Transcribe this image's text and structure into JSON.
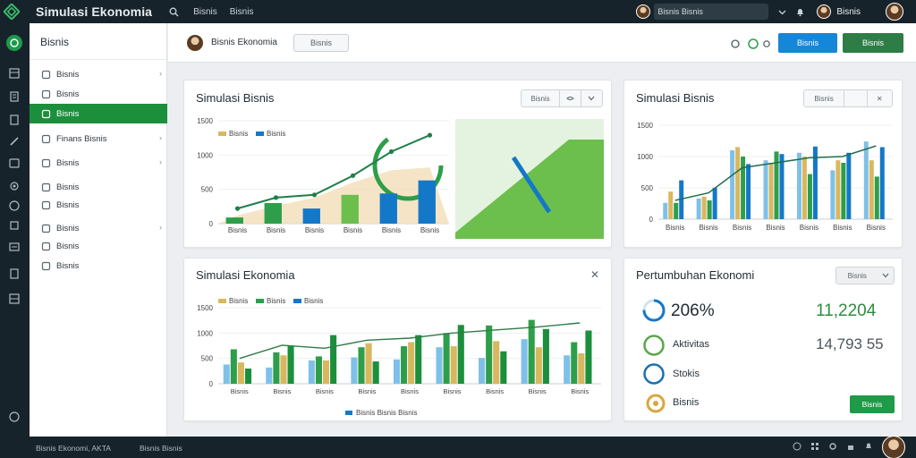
{
  "app": {
    "title": "Simulasi Ekonomia"
  },
  "topbar": {
    "menu": [
      "Bisnis",
      "Bisnis"
    ],
    "search_text": "Bisnis Bisnis",
    "user_name": "Bisnis"
  },
  "sidebar": {
    "title": "Bisnis",
    "items": [
      {
        "label": "Bisnis",
        "icon": "briefcase-icon",
        "chevron": true
      },
      {
        "label": "Bisnis",
        "icon": "twitter-bird-icon",
        "chevron": false
      },
      {
        "label": "Bisnis",
        "icon": "chart-icon",
        "chevron": false,
        "active": true
      },
      {
        "label": "Finans Bisnis",
        "icon": "chat-icon",
        "chevron": true
      },
      {
        "label": "Bisnis",
        "icon": "clock-icon",
        "chevron": true
      },
      {
        "label": "Bisnis",
        "icon": "calendar-icon",
        "chevron": false
      },
      {
        "label": "Bisnis",
        "icon": "document-icon",
        "chevron": false
      },
      {
        "label": "Bisnis",
        "icon": "mail-icon",
        "chevron": true
      },
      {
        "label": "Bisnis",
        "icon": "list-icon",
        "chevron": false
      },
      {
        "label": "Bisnis",
        "icon": "grid-icon",
        "chevron": false
      }
    ]
  },
  "header": {
    "name": "Bisnis Ekonomia",
    "outline_button": "Bisnis",
    "blue_button": "Bisnis",
    "green_button": "Bisnis"
  },
  "cards": {
    "a": {
      "title": "Simulasi Bisnis",
      "seg": [
        "Bisnis",
        ""
      ]
    },
    "b": {
      "title": "Simulasi Bisnis",
      "seg": [
        "Bisnis",
        ""
      ]
    },
    "c": {
      "title": "Simulasi Ekonomia"
    },
    "d": {
      "title": "Pertumbuhan Ekonomi",
      "dropdown": "Bisnis",
      "button": "Bisnis"
    }
  },
  "stats": {
    "s1": {
      "label": "206%",
      "value": "11,2204"
    },
    "s2": {
      "label": "Aktivitas",
      "value": "14,793 55"
    },
    "s3": {
      "label": "Stokis"
    },
    "s4": {
      "label": "Bisnis"
    }
  },
  "footer": {
    "left": "Bisnis Ekonomi, AKTA",
    "mid": "Bisnis Bisnis"
  },
  "colors": {
    "green": "#2e9e4a",
    "blue": "#1478c8",
    "gold": "#d9b75f",
    "sky": "#7fc0e8",
    "dark": "#17232b"
  },
  "chart_data": [
    {
      "type": "bar",
      "title": "Simulasi Bisnis",
      "categories": [
        "Bisnis",
        "Bisnis",
        "Bisnis",
        "Bisnis",
        "Bisnis",
        "Bisnis"
      ],
      "ylim": [
        0,
        1500
      ],
      "yticks": [
        0,
        500,
        1000,
        1500
      ],
      "ytick_labels": [
        "0",
        "500",
        "1000",
        "1500"
      ],
      "legend": [
        "Bisnis",
        "Bisnis"
      ],
      "series": [
        {
          "name": "Bisnis",
          "type": "bar",
          "values": [
            90,
            300,
            220,
            420,
            440,
            630
          ]
        },
        {
          "name": "Bisnis",
          "type": "line",
          "values": [
            220,
            380,
            420,
            700,
            1050,
            1290
          ]
        }
      ]
    },
    {
      "type": "bar",
      "title": "Simulasi Bisnis",
      "categories": [
        "Bisnis",
        "Bisnis",
        "Bisnis",
        "Bisnis",
        "Bisnis",
        "Bisnis",
        "Bisnis"
      ],
      "ylim": [
        0,
        1500
      ],
      "yticks": [
        0,
        500,
        1000,
        1500
      ],
      "ytick_labels": [
        "0",
        "500",
        "1000",
        "1500"
      ],
      "series": [
        {
          "name": "A",
          "values": [
            260,
            330,
            1100,
            940,
            1060,
            780,
            1240
          ]
        },
        {
          "name": "B",
          "values": [
            440,
            360,
            1150,
            900,
            1000,
            940,
            940
          ]
        },
        {
          "name": "C",
          "values": [
            260,
            300,
            1000,
            1080,
            720,
            900,
            680
          ]
        },
        {
          "name": "D",
          "values": [
            620,
            500,
            880,
            1040,
            1160,
            1060,
            1150
          ]
        },
        {
          "name": "line",
          "type": "line",
          "values": [
            300,
            420,
            820,
            900,
            980,
            1000,
            1170
          ]
        }
      ]
    },
    {
      "type": "bar",
      "title": "Simulasi Ekonomia",
      "categories": [
        "Bisnis",
        "Bisnis",
        "Bisnis",
        "Bisnis",
        "Bisnis",
        "Bisnis",
        "Bisnis",
        "Bisnis",
        "Bisnis"
      ],
      "ylim": [
        0,
        1500
      ],
      "yticks": [
        0,
        500,
        1000,
        1500
      ],
      "ytick_labels": [
        "0",
        "500",
        "1000",
        "1500"
      ],
      "legend": [
        "Bisnis",
        "Bisnis",
        "Bisnis"
      ],
      "series": [
        {
          "name": "A",
          "values": [
            380,
            320,
            460,
            520,
            480,
            720,
            510,
            880,
            560
          ]
        },
        {
          "name": "B",
          "values": [
            680,
            620,
            540,
            720,
            740,
            1000,
            1150,
            1260,
            820
          ]
        },
        {
          "name": "C",
          "values": [
            420,
            560,
            460,
            800,
            820,
            740,
            840,
            720,
            600
          ]
        },
        {
          "name": "D",
          "values": [
            300,
            740,
            960,
            440,
            960,
            1160,
            640,
            1080,
            1050
          ]
        },
        {
          "name": "line",
          "type": "line",
          "values": [
            500,
            760,
            700,
            860,
            900,
            1000,
            1060,
            1120,
            1200
          ]
        }
      ],
      "footer_legend": "Bisnis Bisnis Bisnis"
    }
  ]
}
